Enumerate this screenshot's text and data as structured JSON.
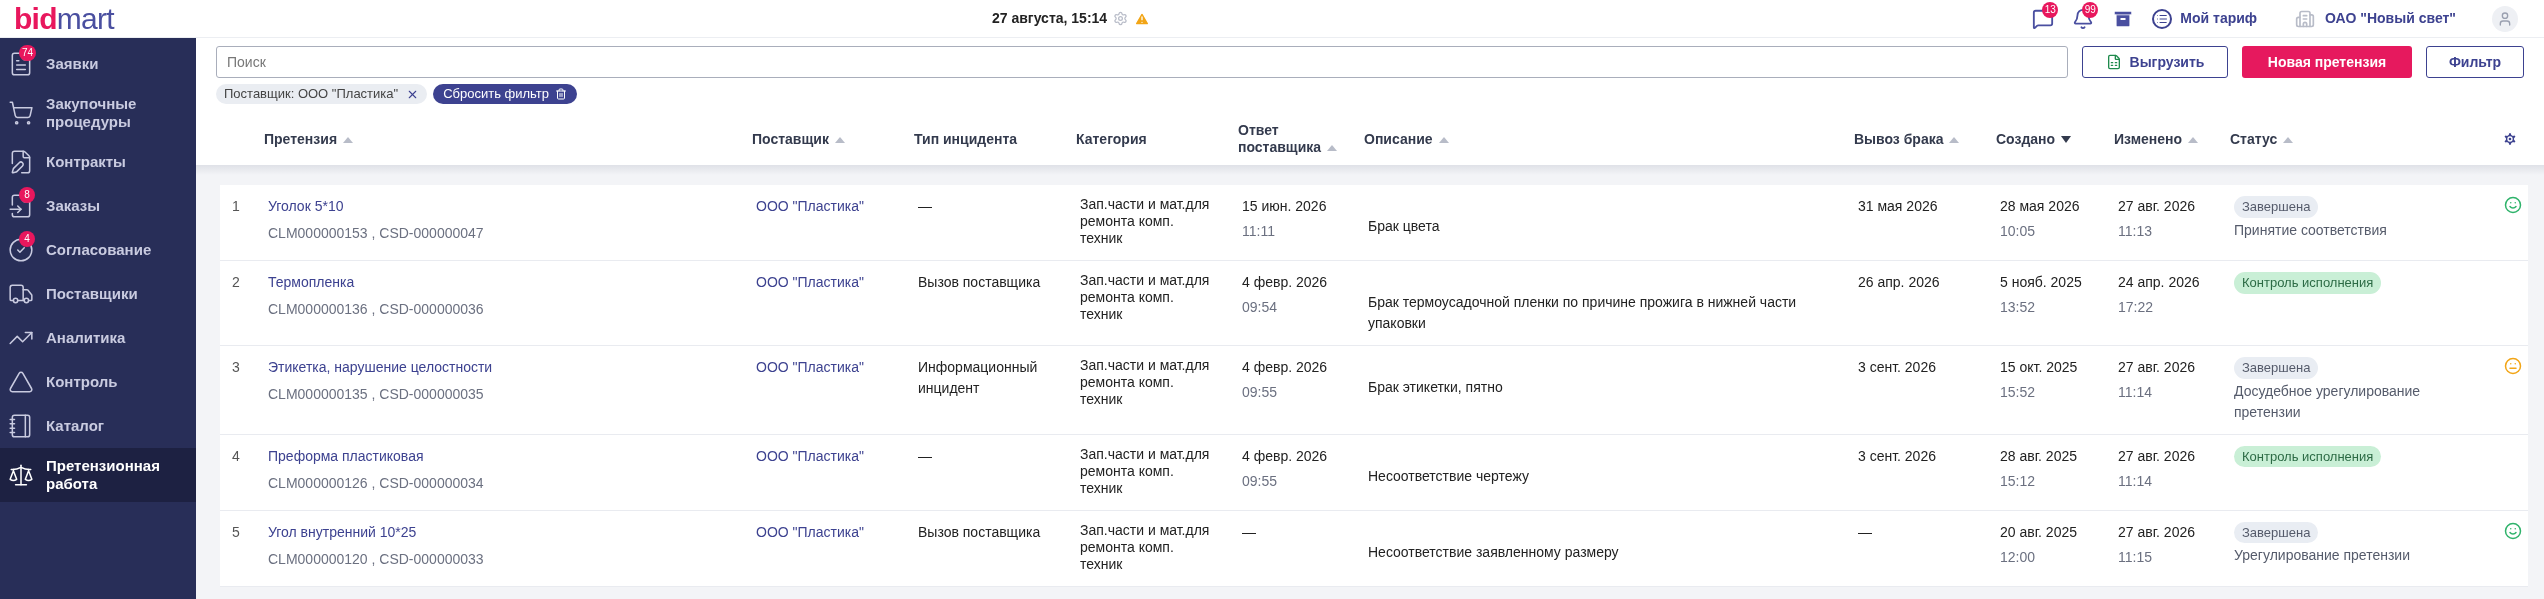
{
  "logo": {
    "accent": "bid",
    "rest": "mart"
  },
  "top_bar": {
    "datetime": "27 августа, 15:14",
    "messages_badge": "13",
    "notifications_badge": "99",
    "tariff": "Мой тариф",
    "company": "ОАО \"Новый свет\""
  },
  "sidebar": {
    "items": [
      {
        "kind": "requests",
        "label": "Заявки",
        "badge": "74",
        "selected": false
      },
      {
        "kind": "procurement",
        "label": "Закупочные процедуры",
        "selected": false
      },
      {
        "kind": "contracts",
        "label": "Контракты",
        "selected": false
      },
      {
        "kind": "orders",
        "label": "Заказы",
        "badge": "8",
        "selected": false
      },
      {
        "kind": "approval",
        "label": "Согласование",
        "badge": "4",
        "selected": false
      },
      {
        "kind": "suppliers",
        "label": "Поставщики",
        "selected": false
      },
      {
        "kind": "analytics",
        "label": "Аналитика",
        "selected": false
      },
      {
        "kind": "control",
        "label": "Контроль",
        "selected": false
      },
      {
        "kind": "catalog",
        "label": "Каталог",
        "selected": false
      },
      {
        "kind": "claims",
        "label": "Претензионная работа",
        "selected": true
      }
    ]
  },
  "toolbar": {
    "search": {
      "placeholder": "Поиск"
    },
    "export": "Выгрузить",
    "new_claim": "Новая претензия",
    "filter": "Фильтр"
  },
  "filters": {
    "chip": "Поставщик: ООО \"Пластика\"",
    "reset": "Сбросить фильтр"
  },
  "table": {
    "columns": [
      {
        "label": "Претензия",
        "sortable": true,
        "selected": false
      },
      {
        "label": "Поставщик",
        "sortable": true,
        "selected": false
      },
      {
        "label": "Тип инцидента",
        "sortable": false
      },
      {
        "label": "Категория",
        "sortable": false
      },
      {
        "label": "Ответ поставщика",
        "sortable": true,
        "selected": false
      },
      {
        "label": "Описание",
        "sortable": true,
        "selected": false
      },
      {
        "label": "Вывоз брака",
        "sortable": true,
        "selected": false
      },
      {
        "label": "Создано",
        "sortable": true,
        "selected": true
      },
      {
        "label": "Изменено",
        "sortable": true,
        "selected": false
      },
      {
        "label": "Статус",
        "sortable": true,
        "selected": false
      }
    ],
    "rows": [
      {
        "number": "1",
        "title": "Уголок 5*10",
        "codes": "CLM000000153 , CSD-000000047",
        "supplier": "ООО \"Пластика\"",
        "incident": "—",
        "category": "Зап.части и мат.для ремонта комп. техник",
        "response": {
          "date": "15 июн. 2026",
          "time": "11:11"
        },
        "description": "Брак цвета",
        "removal": "31 мая 2026",
        "created": {
          "date": "28 мая 2026",
          "time": "10:05"
        },
        "changed": {
          "date": "27 авг. 2026",
          "time": "11:13"
        },
        "status": {
          "label": "Завершена",
          "kind": "completed"
        },
        "status_note": "Принятие соответствия",
        "rating": {
          "kind": "good"
        }
      },
      {
        "number": "2",
        "title": "Термопленка",
        "codes": "CLM000000136 , CSD-000000036",
        "supplier": "ООО \"Пластика\"",
        "incident": "Вызов поставщика",
        "category": "Зап.части и мат.для ремонта комп. техник",
        "response": {
          "date": "4 февр. 2026",
          "time": "09:54"
        },
        "description": "Брак термоусадочной пленки по причине прожига в нижней части упаковки",
        "removal": "26 апр. 2026",
        "created": {
          "date": "5 нояб. 2025",
          "time": "13:52"
        },
        "changed": {
          "date": "24 апр. 2026",
          "time": "17:22"
        },
        "status": {
          "label": "Контроль исполнения",
          "kind": "in_progress"
        }
      },
      {
        "number": "3",
        "title": "Этикетка, нарушение целостности",
        "codes": "CLM000000135 , CSD-000000035",
        "supplier": "ООО \"Пластика\"",
        "incident": "Информационный инцидент",
        "category": "Зап.части и мат.для ремонта комп. техник",
        "response": {
          "date": "4 февр. 2026",
          "time": "09:55"
        },
        "description": "Брак этикетки, пятно",
        "removal": "3 сент. 2026",
        "created": {
          "date": "15 окт. 2025",
          "time": "15:52"
        },
        "changed": {
          "date": "27 авг. 2026",
          "time": "11:14"
        },
        "status": {
          "label": "Завершена",
          "kind": "completed"
        },
        "status_note": "Досудебное урегулирование претензии",
        "rating": {
          "kind": "neutral"
        }
      },
      {
        "number": "4",
        "title": "Преформа пластиковая",
        "codes": "CLM000000126 , CSD-000000034",
        "supplier": "ООО \"Пластика\"",
        "incident": "—",
        "category": "Зап.части и мат.для ремонта комп. техник",
        "response": {
          "date": "4 февр. 2026",
          "time": "09:55"
        },
        "description": "Несоответствие чертежу",
        "removal": "3 сент. 2026",
        "created": {
          "date": "28 авг. 2025",
          "time": "15:12"
        },
        "changed": {
          "date": "27 авг. 2026",
          "time": "11:14"
        },
        "status": {
          "label": "Контроль исполнения",
          "kind": "in_progress"
        }
      },
      {
        "number": "5",
        "title": "Угол внутренний 10*25",
        "codes": "CLM000000120 , CSD-000000033",
        "supplier": "ООО \"Пластика\"",
        "incident": "Вызов поставщика",
        "category": "Зап.части и мат.для ремонта комп. техник",
        "response": {
          "date": "—"
        },
        "description": "Несоответствие заявленному размеру",
        "removal": "—",
        "created": {
          "date": "20 авг. 2025",
          "time": "12:00"
        },
        "changed": {
          "date": "27 авг. 2026",
          "time": "11:15"
        },
        "status": {
          "label": "Завершена",
          "kind": "completed"
        },
        "status_note": "Урегулирование претензии",
        "rating": {
          "kind": "good"
        }
      }
    ]
  }
}
